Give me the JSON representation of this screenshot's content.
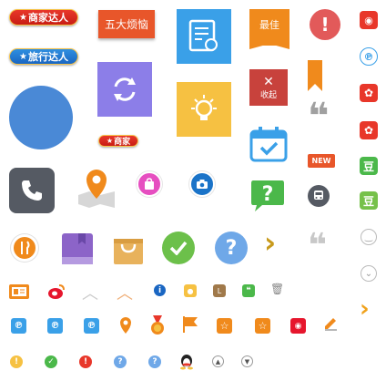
{
  "badges": {
    "merchant_expert": "商家达人",
    "travel_expert": "旅行达人",
    "merchant": "商家",
    "five_worries": "五大烦恼",
    "best": "最佳",
    "collapse": "收起",
    "new": "NEW"
  },
  "glyphs": {
    "star": "★",
    "quote": "❝",
    "bean": "豆",
    "chevron": "›"
  },
  "colors": {
    "red": "#e8372a",
    "blue": "#3aa0e8",
    "orange": "#f08a1c",
    "green": "#4bb84a",
    "purple": "#8c7ee8",
    "yellow": "#f6c142",
    "dark": "#555a63",
    "sina": "#e6162d"
  },
  "icons": [
    "star-icon",
    "circle-icon",
    "certificate-icon",
    "exclamation-icon",
    "weibo-icon",
    "refresh-icon",
    "close-icon",
    "bookmark-icon",
    "lightbulb-icon",
    "calendar-check-icon",
    "quote-icon",
    "phone-icon",
    "location-map-icon",
    "bag-icon",
    "camera-icon",
    "question-bubble-icon",
    "bus-icon",
    "fork-knife-icon",
    "book-icon",
    "shopping-bag-icon",
    "check-icon",
    "question-icon",
    "chevron-right-icon",
    "smiley-icon",
    "chevron-down-icon",
    "id-card-icon",
    "chevron-up-icon",
    "info-icon",
    "trash-icon",
    "flag-icon",
    "qq-penguin-icon",
    "triangle-up-icon",
    "triangle-down-icon"
  ]
}
